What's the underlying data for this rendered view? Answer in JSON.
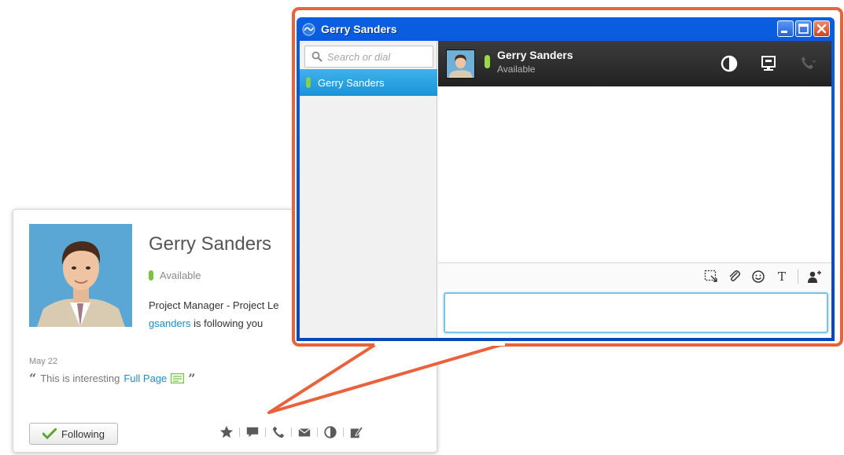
{
  "card": {
    "name": "Gerry Sanders",
    "status": "Available",
    "role": "Project Manager - Project Le",
    "follow_user": "gsanders",
    "follow_text": " is following you",
    "date": "May 22",
    "quote_text": "This is interesting",
    "quote_link": "Full Page",
    "following_button": "Following",
    "actions": [
      "star-icon",
      "chat-icon",
      "phone-icon",
      "mail-icon",
      "contrast-icon",
      "edit-icon"
    ]
  },
  "chat_window": {
    "title": "Gerry Sanders",
    "search_placeholder": "Search or dial",
    "contacts": [
      {
        "name": "Gerry Sanders",
        "status_color": "#86d04a"
      }
    ],
    "header": {
      "name": "Gerry Sanders",
      "status": "Available"
    },
    "header_actions": [
      "contrast-icon",
      "screen-share-icon",
      "phone-icon"
    ],
    "toolbar": [
      "screen-capture-icon",
      "attach-icon",
      "emoticon-icon",
      "text-format-icon",
      "add-participant-icon"
    ],
    "toolbar_text_label": "T"
  },
  "colors": {
    "highlight": "#e8623c",
    "title_bar": "#0a5ee0",
    "selected_row": "#1a93d6",
    "available": "#7bc242",
    "link": "#1b8ec9"
  }
}
